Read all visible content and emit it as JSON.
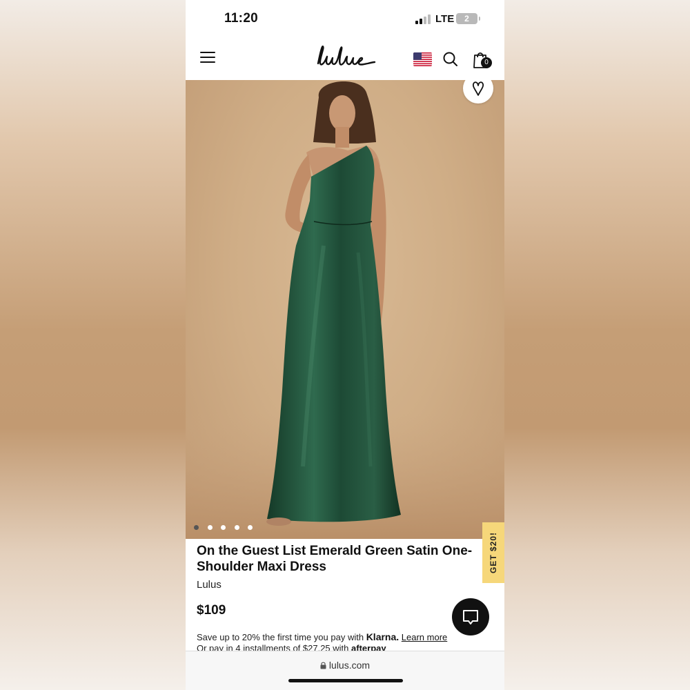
{
  "status_bar": {
    "time": "11:20",
    "network": "LTE",
    "battery": "2"
  },
  "nav": {
    "logo": "lulus",
    "cart_count": "0",
    "icons": [
      "menu-icon",
      "us-flag-icon",
      "search-icon",
      "shopping-bag-icon"
    ]
  },
  "hero": {
    "image_description_icon": "product-photo",
    "wishlist_icon": "heart-icon",
    "carousel": {
      "total": 5,
      "active_index": 0
    }
  },
  "promo_tab": {
    "label": "GET $20!"
  },
  "product": {
    "title": "On the Guest List Emerald Green Satin One-Shoulder Maxi Dress",
    "brand": "Lulus",
    "price": "$109"
  },
  "payment": {
    "klarna_prefix": "Save up to 20% the first time you pay with ",
    "klarna_brand": "Klarna.",
    "klarna_link": "Learn more",
    "afterpay_prefix": "Or pay in 4 installments of $27.25 with ",
    "afterpay_brand": "afterpay"
  },
  "browser": {
    "url": "lulus.com"
  },
  "colors": {
    "dress": "#1f4a35",
    "background": "#cfad86",
    "promo": "#f6d77a",
    "text": "#111111"
  }
}
